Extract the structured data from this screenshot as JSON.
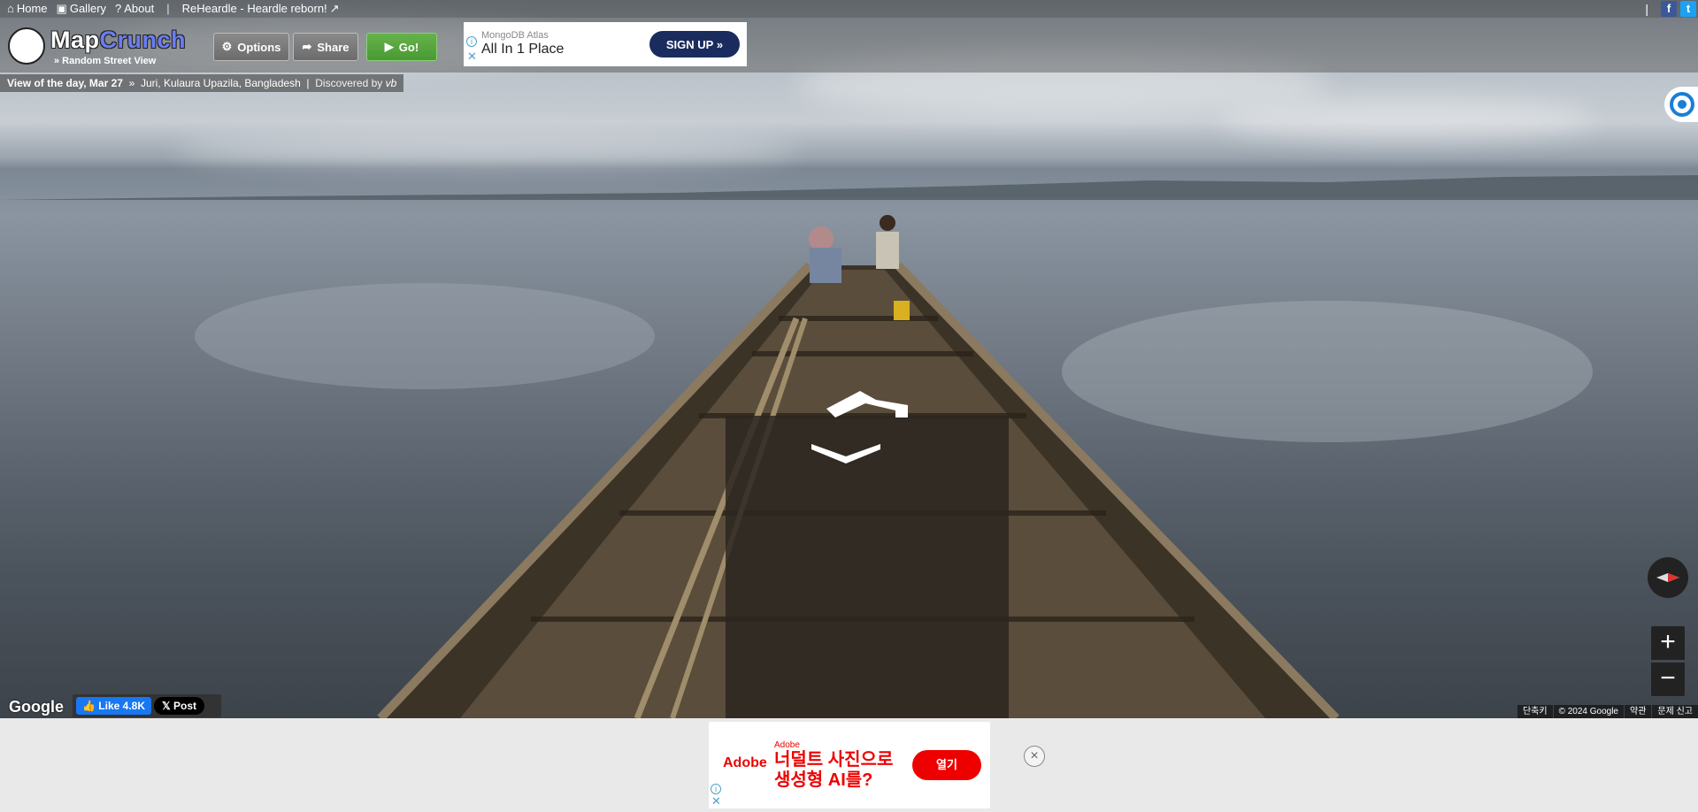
{
  "topbar": {
    "links": [
      {
        "label": "Home",
        "icon": "home-icon"
      },
      {
        "label": "Gallery",
        "icon": "image-icon"
      },
      {
        "label": "About",
        "icon": "question-icon"
      }
    ],
    "promo": "ReHeardle - Heardle reborn!",
    "promo_icon": "external-link-icon",
    "facebook": "f",
    "twitter": "t"
  },
  "header": {
    "logo_map": "Map",
    "logo_crunch": "Crunch",
    "tagline": "» Random Street View",
    "options_label": "Options",
    "share_label": "Share",
    "go_label": "Go!"
  },
  "ad_top": {
    "brand": "MongoDB Atlas",
    "tagline": "All In 1 Place",
    "cta": "SIGN UP"
  },
  "votd": {
    "label": "View of the day, Mar 27",
    "location": "Juri, Kulaura Upazila, Bangladesh",
    "discovered": "Discovered by",
    "author": "vb"
  },
  "map_controls": {
    "zoom_in": "+",
    "zoom_out": "−"
  },
  "footer_overlay": {
    "google": "Google",
    "fb_like": "Like 4.8K",
    "x_post": "Post",
    "credits": [
      "단축키",
      "© 2024 Google",
      "약관",
      "문제 신고"
    ]
  },
  "ad_bottom": {
    "logo": "Adobe",
    "brand": "Adobe",
    "message_line1": "너덜트 사진으로",
    "message_line2": "생성형 AI를?",
    "cta": "열기",
    "close": "×"
  },
  "colors": {
    "accent_blue": "#6a7df0",
    "go_green": "#4a9a34",
    "facebook": "#3b5998",
    "twitter": "#1da1f2",
    "adobe_red": "#e00000",
    "mongodb_navy": "#1a2b5e"
  }
}
